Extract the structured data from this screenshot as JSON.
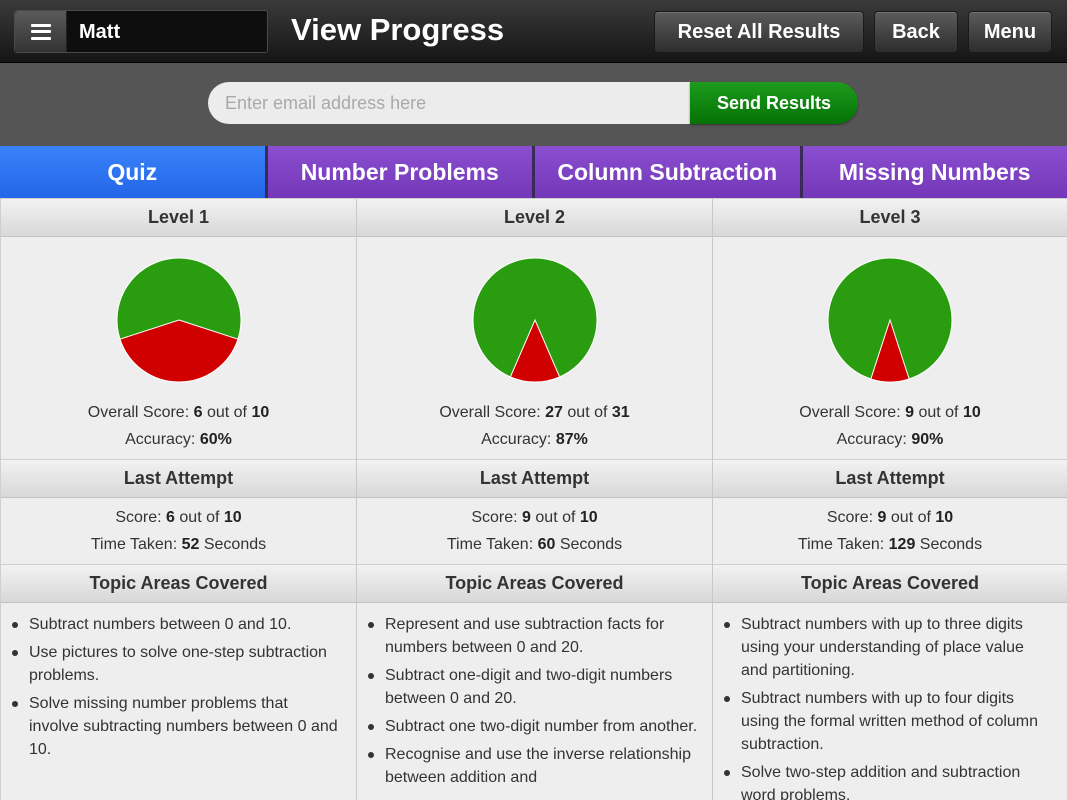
{
  "header": {
    "user_name": "Matt",
    "title": "View Progress",
    "buttons": {
      "reset": "Reset All Results",
      "back": "Back",
      "menu": "Menu"
    }
  },
  "email": {
    "placeholder": "Enter email address here",
    "send_label": "Send Results"
  },
  "tabs": [
    {
      "label": "Quiz",
      "active": true
    },
    {
      "label": "Number Problems",
      "active": false
    },
    {
      "label": "Column Subtraction",
      "active": false
    },
    {
      "label": "Missing Numbers",
      "active": false
    }
  ],
  "labels": {
    "overall_score": "Overall Score:",
    "out_of": "out of",
    "accuracy": "Accuracy:",
    "last_attempt": "Last Attempt",
    "score": "Score:",
    "time_taken": "Time Taken:",
    "seconds": "Seconds",
    "topic_areas": "Topic Areas Covered"
  },
  "colors": {
    "correct": "#2a9c10",
    "incorrect": "#d10000",
    "active_tab": "#2f76f2",
    "tab": "#7e44c4",
    "send_button": "#0e870e"
  },
  "levels": [
    {
      "title": "Level 1",
      "overall_score": "6",
      "overall_total": "10",
      "accuracy": "60%",
      "accuracy_fraction": 0.6,
      "last_score": "6",
      "last_total": "10",
      "time_taken": "52",
      "topics": [
        "Subtract numbers between 0 and 10.",
        "Use pictures to solve one-step subtraction problems.",
        "Solve missing number problems that involve subtracting numbers between 0 and 10."
      ]
    },
    {
      "title": "Level 2",
      "overall_score": "27",
      "overall_total": "31",
      "accuracy": "87%",
      "accuracy_fraction": 0.87,
      "last_score": "9",
      "last_total": "10",
      "time_taken": "60",
      "topics": [
        "Represent and use subtraction facts for numbers between 0 and 20.",
        "Subtract one-digit and two-digit numbers between 0 and 20.",
        "Subtract one two-digit number from another.",
        "Recognise and use the inverse relationship between addition and"
      ]
    },
    {
      "title": "Level 3",
      "overall_score": "9",
      "overall_total": "10",
      "accuracy": "90%",
      "accuracy_fraction": 0.9,
      "last_score": "9",
      "last_total": "10",
      "time_taken": "129",
      "topics": [
        "Subtract numbers with up to three digits using your understanding of place value and partitioning.",
        "Subtract numbers with up to four digits using the formal written method of column subtraction.",
        "Solve two-step addition and subtraction word problems."
      ]
    }
  ]
}
